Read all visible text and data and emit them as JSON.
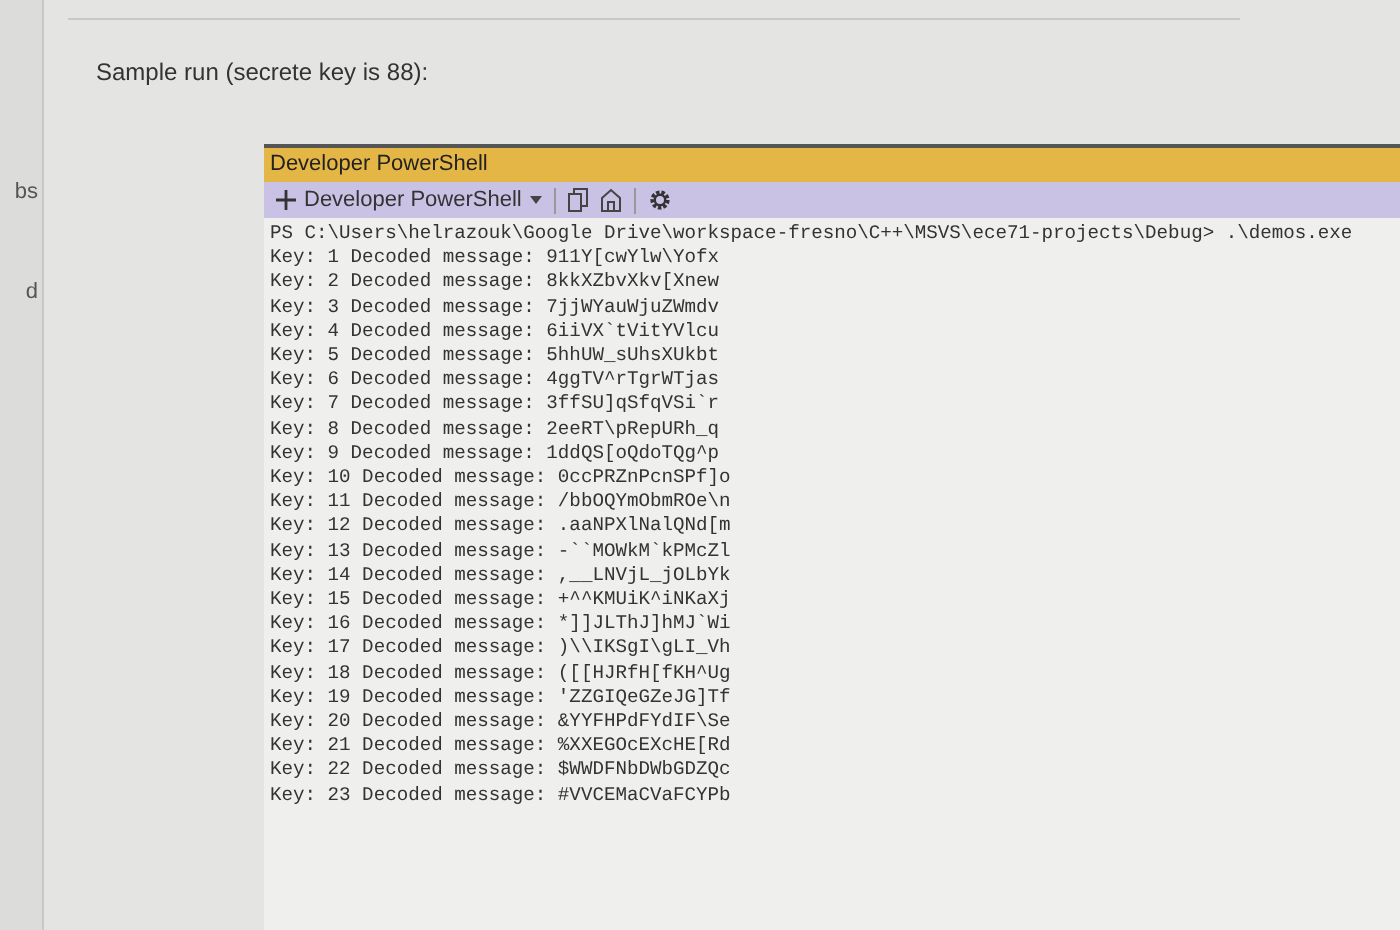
{
  "sidebar_fragments": [
    "bs",
    "d"
  ],
  "heading": "Sample run (secrete key is 88):",
  "terminal": {
    "title": "Developer PowerShell",
    "tab_label": "Developer PowerShell",
    "lines": [
      "PS C:\\Users\\helrazouk\\Google Drive\\workspace-fresno\\C++\\MSVS\\ece71-projects\\Debug> .\\demos.exe",
      "Key: 1 Decoded message: 911Y[cwYlw\\Yofx",
      "Key: 2 Decoded message: 8kkXZbvXkv[Xnew",
      "Key: 3 Decoded message: 7jjWYauWjuZWmdv",
      "Key: 4 Decoded message: 6iiVX`tVitYVlcu",
      "Key: 5 Decoded message: 5hhUW_sUhsXUkbt",
      "Key: 6 Decoded message: 4ggTV^rTgrWTjas",
      "Key: 7 Decoded message: 3ffSU]qSfqVSi`r",
      "Key: 8 Decoded message: 2eeRT\\pRepURh_q",
      "Key: 9 Decoded message: 1ddQS[oQdoTQg^p",
      "Key: 10 Decoded message: 0ccPRZnPcnSPf]o",
      "Key: 11 Decoded message: /bbOQYmObmROe\\n",
      "Key: 12 Decoded message: .aaNPXlNalQNd[m",
      "Key: 13 Decoded message: -``MOWkM`kPMcZl",
      "Key: 14 Decoded message: ,__LNVjL_jOLbYk",
      "Key: 15 Decoded message: +^^KMUiK^iNKaXj",
      "Key: 16 Decoded message: *]]JLThJ]hMJ`Wi",
      "Key: 17 Decoded message: )\\\\IKSgI\\gLI_Vh",
      "Key: 18 Decoded message: ([[HJRfH[fKH^Ug",
      "Key: 19 Decoded message: 'ZZGIQeGZeJG]Tf",
      "Key: 20 Decoded message: &YYFHPdFYdIF\\Se",
      "Key: 21 Decoded message: %XXEGOcEXcHE[Rd",
      "Key: 22 Decoded message: $WWDFNbDWbGDZQc",
      "Key: 23 Decoded message: #VVCEMaCVaFCYPb"
    ]
  }
}
